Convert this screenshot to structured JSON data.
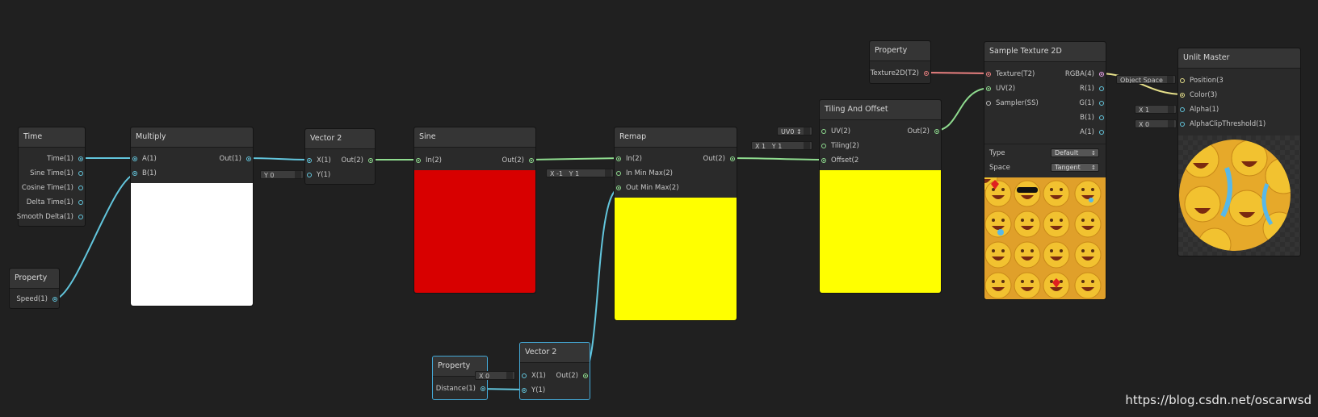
{
  "nodes": {
    "time": {
      "title": "Time",
      "outputs": [
        "Time(1)",
        "Sine Time(1)",
        "Cosine Time(1)",
        "Delta Time(1)",
        "Smooth Delta(1)"
      ]
    },
    "speed": {
      "title": "Property",
      "output": "Speed(1)"
    },
    "multiply": {
      "title": "Multiply",
      "inputs": [
        "A(1)",
        "B(1)"
      ],
      "output": "Out(1)",
      "preview_color": "#ffffff"
    },
    "vector2a": {
      "title": "Vector 2",
      "inputs": [
        "X(1)",
        "Y(1)"
      ],
      "output": "Out(2)",
      "y_field": "Y  0"
    },
    "sine": {
      "title": "Sine",
      "input": "In(2)",
      "output": "Out(2)",
      "preview_color": "#d80000"
    },
    "remap": {
      "title": "Remap",
      "inputs": [
        "In(2)",
        "In Min Max(2)",
        "Out Min Max(2)"
      ],
      "output": "Out(2)",
      "x_field": "X  -1",
      "y_field": "Y  1",
      "preview_color": "#ffff00"
    },
    "distance": {
      "title": "Property",
      "output": "Distance(1)"
    },
    "vector2b": {
      "title": "Vector 2",
      "inputs": [
        "X(1)",
        "Y(1)"
      ],
      "output": "Out(2)",
      "x_field": "X  0"
    },
    "tiling": {
      "title": "Tiling And Offset",
      "inputs": [
        "UV(2)",
        "Tiling(2)",
        "Offset(2"
      ],
      "output": "Out(2)",
      "uv_field": "UV0 ↕",
      "tiling_x": "X  1",
      "tiling_y": "Y  1",
      "preview_color": "#ffff00"
    },
    "texprop": {
      "title": "Property",
      "output": "Texture2D(T2)"
    },
    "sample": {
      "title": "Sample Texture 2D",
      "inputs": [
        "Texture(T2)",
        "UV(2)",
        "Sampler(SS)"
      ],
      "outputs": [
        "RGBA(4)",
        "R(1)",
        "G(1)",
        "B(1)",
        "A(1)"
      ],
      "type_label": "Type",
      "type_value": "Default",
      "space_label": "Space",
      "space_value": "Tangent"
    },
    "master": {
      "title": "Unlit Master",
      "inputs": [
        "Position(3",
        "Color(3)",
        "Alpha(1)",
        "AlphaClipThreshold(1)"
      ],
      "pos_field": "Object Space",
      "alpha_field": "X  1",
      "clip_field": "X  0"
    }
  },
  "watermark": "https://blog.csdn.net/oscarwsd",
  "colors": {
    "background": "#202020",
    "wire_float": "#62c5dc",
    "wire_vec2": "#8fdc8f",
    "wire_tex": "#ea8080",
    "wire_vec3": "#e6e08a"
  }
}
